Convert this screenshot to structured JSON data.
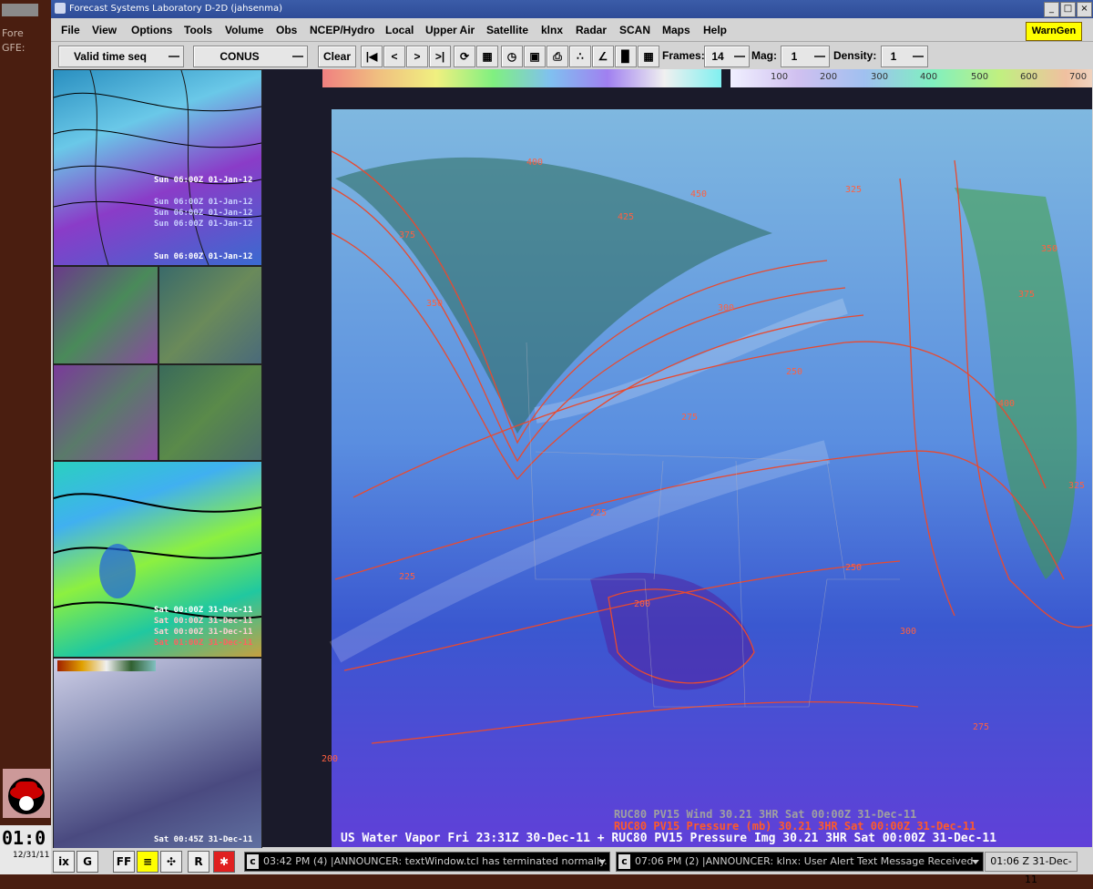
{
  "desktop": {
    "items": [
      {
        "label": "Fore"
      },
      {
        "label": "GFE:"
      }
    ],
    "clock_time": "01:0",
    "clock_date": "12/31/11"
  },
  "window": {
    "title": "Forecast Systems Laboratory D-2D (jahsenma)",
    "controls": [
      "_",
      "□",
      "×"
    ]
  },
  "menubar": {
    "items": [
      "File",
      "View",
      "Options",
      "Tools",
      "Volume",
      "Obs",
      "NCEP/Hydro",
      "Local",
      "Upper Air",
      "Satellite",
      "klnx",
      "Radar",
      "SCAN",
      "Maps",
      "Help"
    ],
    "warngen": "WarnGen"
  },
  "toolbar": {
    "loop_mode": "Valid time seq",
    "scale": "CONUS",
    "clear": "Clear",
    "frames_label": "Frames:",
    "frames_value": "14",
    "mag_label": "Mag:",
    "mag_value": "1",
    "density_label": "Density:",
    "density_value": "1"
  },
  "colorbar": {
    "ticks": [
      "100",
      "200",
      "300",
      "400",
      "500",
      "600",
      "700"
    ]
  },
  "panes": {
    "p1_time": "Sun 06:00Z 01-Jan-12",
    "p1_stack": [
      "Sun 06:00Z 01-Jan-12",
      "Sun 06:00Z 01-Jan-12",
      "Sun 06:00Z 01-Jan-12",
      "Sun 06:00Z 01-Jan-12"
    ],
    "p4_times": [
      "Sat 00:00Z 31-Dec-11",
      "Sat 00:00Z 31-Dec-11",
      "Sat 00:00Z 31-Dec-11",
      "Sat 01:00Z 31-Dec-11"
    ],
    "p5_time": "Sat 00:45Z 31-Dec-11"
  },
  "main": {
    "contours": [
      "350",
      "375",
      "400",
      "425",
      "450",
      "325",
      "300",
      "275",
      "250",
      "225",
      "200",
      "400",
      "375",
      "350",
      "325",
      "300",
      "275",
      "250",
      "225",
      "200"
    ],
    "legend_line1": "RUC80 PV15 Wind         30.21   3HR Sat 00:00Z 31-Dec-11",
    "legend_line2": "RUC80 PV15 Pressure (mb) 30.21   3HR Sat 00:00Z 31-Dec-11",
    "legend_line3": "US Water Vapor  Fri 23:31Z 30-Dec-11 + RUC80 PV15 Pressure Img  30.21   3HR Sat 00:00Z 31-Dec-11"
  },
  "statusbar": {
    "icons": [
      "ix",
      "G",
      "FF",
      "≡",
      "✣",
      "R",
      "✱"
    ],
    "announcer1": "03:42 PM (4) |ANNOUNCER: textWindow.tcl has terminated normally.",
    "announcer2": "07:06 PM (2) |ANNOUNCER: klnx: User Alert Text Message Received",
    "clock": "01:06 Z 31-Dec-11"
  }
}
